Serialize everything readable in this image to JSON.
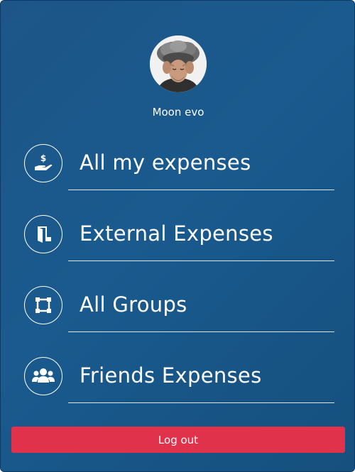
{
  "profile": {
    "name": "Moon evo",
    "avatar_icon": "user-avatar-photo"
  },
  "menu": {
    "items": [
      {
        "label": "All my expenses",
        "icon": "hand-money-icon"
      },
      {
        "label": "External Expenses",
        "icon": "door-exit-icon"
      },
      {
        "label": "All Groups",
        "icon": "group-selection-icon"
      },
      {
        "label": "Friends Expenses",
        "icon": "users-icon"
      }
    ]
  },
  "actions": {
    "logout_label": "Log out"
  },
  "colors": {
    "background": "#1a5a8e",
    "logout": "#e0324a",
    "text": "#ffffff"
  }
}
